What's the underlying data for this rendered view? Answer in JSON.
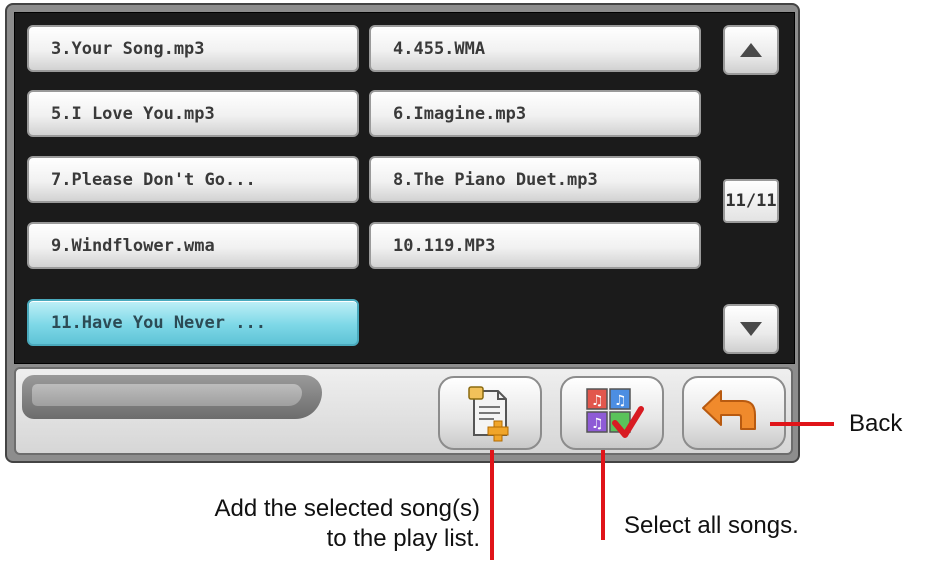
{
  "songs": [
    {
      "label": "3.Your Song.mp3",
      "selected": false
    },
    {
      "label": "4.455.WMA",
      "selected": false
    },
    {
      "label": "5.I Love You.mp3",
      "selected": false
    },
    {
      "label": "6.Imagine.mp3",
      "selected": false
    },
    {
      "label": "7.Please Don't Go...",
      "selected": false
    },
    {
      "label": "8.The Piano Duet.mp3",
      "selected": false
    },
    {
      "label": "9.Windflower.wma",
      "selected": false
    },
    {
      "label": "10.119.MP3",
      "selected": false
    },
    {
      "label": "11.Have You Never ...",
      "selected": true
    }
  ],
  "pager": {
    "indicator": "11/11"
  },
  "icons": {
    "scroll_up": "triangle-up-icon",
    "scroll_down": "triangle-down-icon",
    "add_to_playlist": "document-plus-icon",
    "select_all": "music-grid-check-icon",
    "back": "u-turn-arrow-icon"
  },
  "annotations": {
    "back": "Back",
    "add_line1": "Add the selected song(s)",
    "add_line2": "to the play list.",
    "select_all": "Select all songs."
  },
  "colors": {
    "selected_row": "#7ed8e7",
    "annotation_line": "#e01419",
    "back_arrow": "#f08a2c"
  }
}
